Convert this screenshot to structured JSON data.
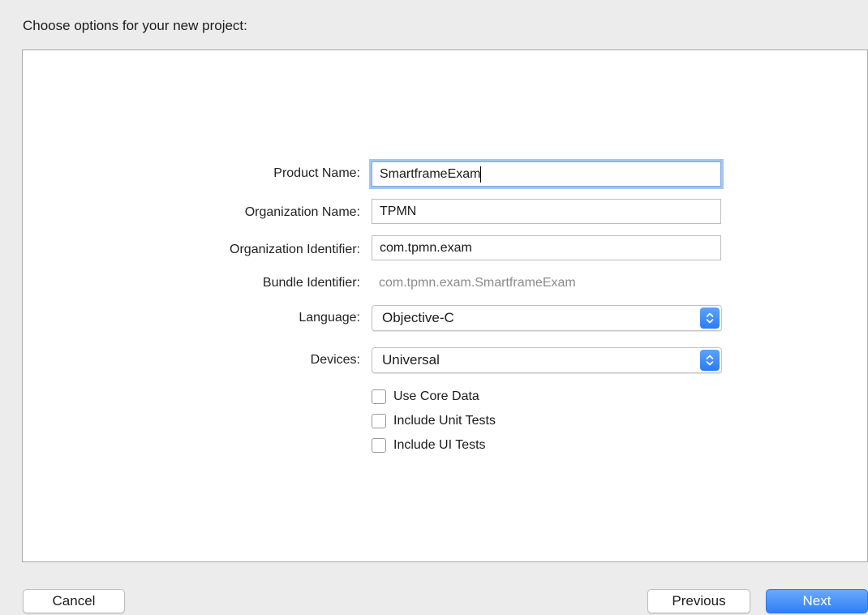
{
  "header": {
    "title": "Choose options for your new project:"
  },
  "form": {
    "product_name": {
      "label": "Product Name:",
      "value": "SmartframeExam"
    },
    "organization_name": {
      "label": "Organization Name:",
      "value": "TPMN"
    },
    "organization_identifier": {
      "label": "Organization Identifier:",
      "value": "com.tpmn.exam"
    },
    "bundle_identifier": {
      "label": "Bundle Identifier:",
      "value": "com.tpmn.exam.SmartframeExam"
    },
    "language": {
      "label": "Language:",
      "selected": "Objective-C"
    },
    "devices": {
      "label": "Devices:",
      "selected": "Universal"
    },
    "checkboxes": [
      {
        "label": "Use Core Data",
        "checked": false
      },
      {
        "label": "Include Unit Tests",
        "checked": false
      },
      {
        "label": "Include UI Tests",
        "checked": false
      }
    ]
  },
  "footer": {
    "cancel_label": "Cancel",
    "previous_label": "Previous",
    "next_label": "Next"
  },
  "colors": {
    "accent": "#2f80f4",
    "focus_ring": "#a7c4f1",
    "background": "#ececec"
  },
  "icons": {
    "popup_arrows": "up-down-chevron-icon",
    "checkbox": "checkbox-unchecked"
  }
}
